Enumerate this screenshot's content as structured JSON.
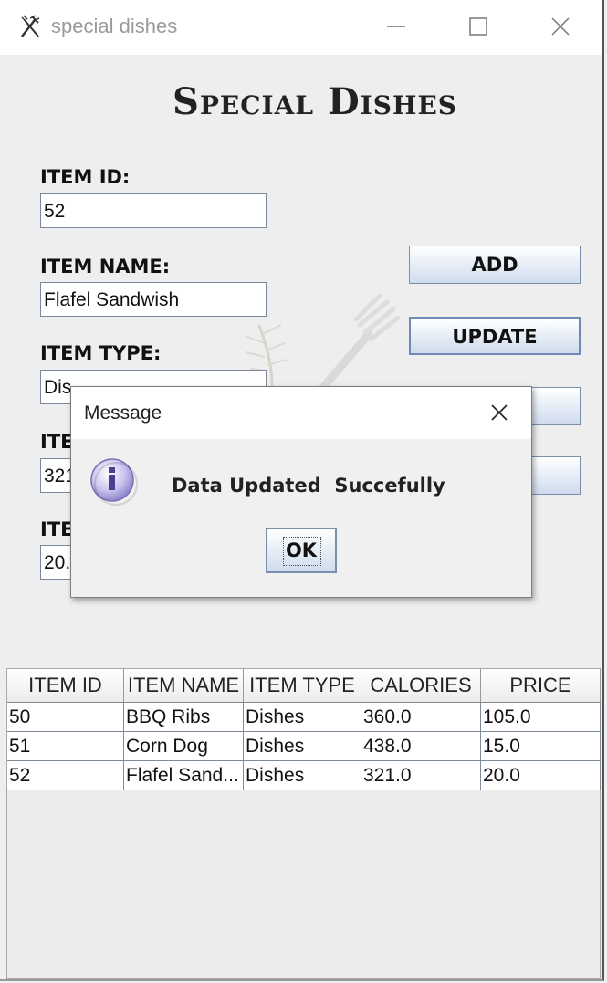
{
  "window": {
    "title": "special dishes"
  },
  "form": {
    "heading": "Special Dishes",
    "item_id_label": "ITEM ID:",
    "item_id_value": "52",
    "item_name_label": "ITEM NAME:",
    "item_name_value": "Flafel Sandwish",
    "item_type_label": "ITEM TYPE:",
    "item_type_value": "Dis",
    "calories_label": "ITE",
    "calories_value": "321",
    "price_label": "ITE",
    "price_value": "20."
  },
  "buttons": {
    "add": "ADD",
    "update": "UPDATE"
  },
  "table": {
    "columns": [
      "ITEM ID",
      "ITEM NAME",
      "ITEM TYPE",
      "CALORIES",
      "PRICE"
    ],
    "rows": [
      [
        "50",
        "BBQ Ribs",
        "Dishes",
        "360.0",
        "105.0"
      ],
      [
        "51",
        "Corn Dog",
        "Dishes",
        "438.0",
        "15.0"
      ],
      [
        "52",
        "Flafel Sand...",
        "Dishes",
        "321.0",
        "20.0"
      ]
    ]
  },
  "dialog": {
    "title": "Message",
    "message": "Data Updated  Succefully",
    "ok_label": "OK",
    "icon": "info-icon"
  },
  "colors": {
    "accent": "#cfdcee",
    "border": "#7a8fae",
    "info_icon": "#b9b2e6"
  }
}
